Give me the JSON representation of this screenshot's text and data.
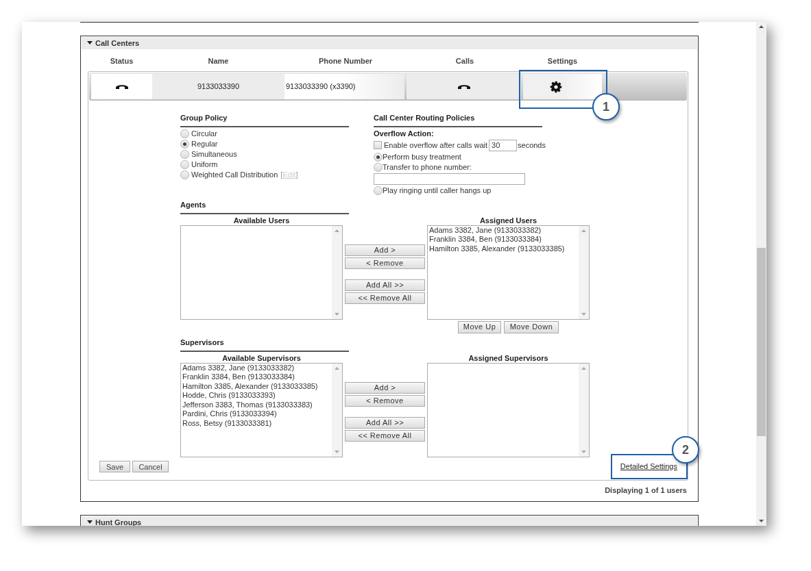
{
  "call_centers": {
    "title": "Call Centers",
    "expanded": true,
    "columns": [
      "Status",
      "Name",
      "Phone Number",
      "Calls",
      "Settings"
    ],
    "row": {
      "name": "9133033390",
      "phone_number": "9133033390 (x3390)"
    },
    "group_policy": {
      "title": "Group Policy",
      "options": [
        {
          "label": "Circular",
          "selected": false
        },
        {
          "label": "Regular",
          "selected": true
        },
        {
          "label": "Simultaneous",
          "selected": false
        },
        {
          "label": "Uniform",
          "selected": false
        },
        {
          "label": "Weighted Call Distribution",
          "selected": false,
          "link_open": "[",
          "link": "Edit",
          "link_close": "]"
        }
      ]
    },
    "routing": {
      "title": "Call Center Routing Policies",
      "subtitle": "Overflow Action:",
      "overflow": {
        "label": "Enable overflow after calls wait",
        "checked": false,
        "value": "30",
        "unit": "seconds"
      },
      "options": [
        {
          "label": "Perform busy treatment",
          "selected": true
        },
        {
          "label": "Transfer to phone number:",
          "selected": false,
          "kind": "field"
        },
        {
          "label": "Play ringing until caller hangs up",
          "selected": false
        }
      ]
    },
    "agents": {
      "title": "Agents",
      "available_label": "Available Users",
      "assigned_label": "Assigned Users",
      "assigned": [
        "Adams 3382, Jane (9133033382)",
        "Franklin 3384, Ben (9133033384)",
        "Hamilton 3385, Alexander (9133033385)"
      ],
      "buttons": [
        "Add >",
        "< Remove",
        "Add All >>",
        "<< Remove All"
      ],
      "order_buttons": [
        "Move Up",
        "Move Down"
      ]
    },
    "supervisors": {
      "title": "Supervisors",
      "available_label": "Available Supervisors",
      "assigned_label": "Assigned Supervisors",
      "available": [
        "Adams 3382, Jane (9133033382)",
        "Franklin 3384, Ben (9133033384)",
        "Hamilton 3385, Alexander (9133033385)",
        "Hodde, Chris (9133033393)",
        "Jefferson 3383, Thomas (9133033383)",
        "Pardini, Chris (9133033394)",
        "Ross, Betsy (9133033381)"
      ],
      "buttons": [
        "Add >",
        "< Remove",
        "Add All >>",
        "<< Remove All"
      ]
    },
    "actions": [
      "Save",
      "Cancel"
    ],
    "detailed_settings": "Detailed Settings",
    "footer": "Displaying 1 of 1 users"
  },
  "hunt_groups": {
    "title": "Hunt Groups",
    "expanded": true
  },
  "callouts": [
    {
      "number": "1"
    },
    {
      "number": "2"
    }
  ]
}
